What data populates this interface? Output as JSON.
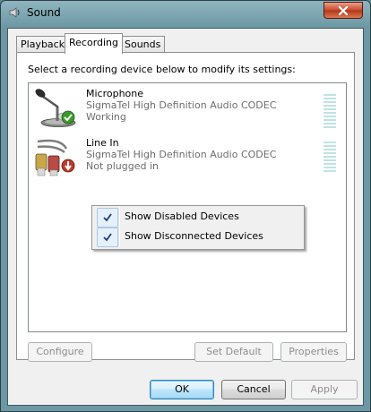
{
  "window": {
    "title": "Sound"
  },
  "tabs": [
    {
      "label": "Playback"
    },
    {
      "label": "Recording"
    },
    {
      "label": "Sounds"
    }
  ],
  "recording": {
    "instruction": "Select a recording device below to modify its settings:",
    "devices": [
      {
        "name": "Microphone",
        "driver": "SigmaTel High Definition Audio CODEC",
        "status": "Working",
        "icon": "microphone-icon",
        "badge": "default-device-check-icon"
      },
      {
        "name": "Line In",
        "driver": "SigmaTel High Definition Audio CODEC",
        "status": "Not plugged in",
        "icon": "line-in-cable-icon",
        "badge": "unplugged-arrow-icon"
      }
    ]
  },
  "context_menu": {
    "items": [
      {
        "label": "Show Disabled Devices",
        "checked": true
      },
      {
        "label": "Show Disconnected Devices",
        "checked": true
      }
    ]
  },
  "panel_buttons": {
    "configure": "Configure",
    "set_default": "Set Default",
    "properties": "Properties"
  },
  "dialog_buttons": {
    "ok": "OK",
    "cancel": "Cancel",
    "apply": "Apply"
  },
  "colors": {
    "title_bar": "#6b98a4",
    "close_button": "#c8482e",
    "check_badge": "#3a9a2a",
    "unplugged_badge": "#c0392b",
    "level_meter": "#bfe3e4"
  }
}
